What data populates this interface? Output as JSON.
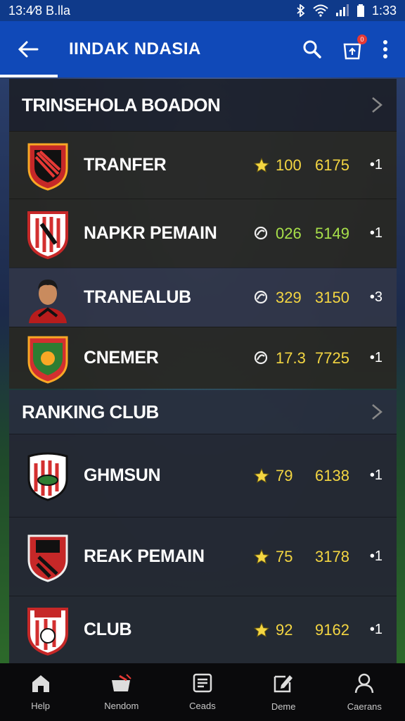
{
  "status": {
    "left": "13:4⁄8 B.lla",
    "time": "1:33"
  },
  "header": {
    "title": "IINDAK NDASIA",
    "notification_count": "0"
  },
  "section1": {
    "title": "TRINSEHOLA BOADON",
    "rows": [
      {
        "name": "TRANFER",
        "v1": "100",
        "v2": "6175",
        "rank": "•1",
        "icon": "star-icon",
        "color": "#f4d642"
      },
      {
        "name": "NAPKR PEMAIN",
        "v1": "026",
        "v2": "5149",
        "rank": "•1",
        "icon": "ball-icon",
        "color": "#a8e04a"
      },
      {
        "name": "TRANEALUB",
        "v1": "329",
        "v2": "3150",
        "rank": "•3",
        "icon": "ball-icon",
        "color": "#f4d642"
      },
      {
        "name": "CNEMER",
        "v1": "17.3",
        "v2": "7725",
        "rank": "•1",
        "icon": "ball-icon",
        "color": "#f4d642"
      }
    ]
  },
  "section2": {
    "title": "RANKING CLUB",
    "rows": [
      {
        "name": "GHMSUN",
        "v1": "79",
        "v2": "6138",
        "rank": "•1",
        "icon": "star-icon",
        "color": "#f4d642"
      },
      {
        "name": "REAK PEMAIN",
        "v1": "75",
        "v2": "3178",
        "rank": "•1",
        "icon": "star-icon",
        "color": "#f4d642"
      },
      {
        "name": "CLUB",
        "v1": "92",
        "v2": "9162",
        "rank": "•1",
        "icon": "star-icon",
        "color": "#f4d642"
      }
    ]
  },
  "nav": [
    {
      "label": "Help",
      "icon": "home-icon"
    },
    {
      "label": "Nendom",
      "icon": "cart-icon"
    },
    {
      "label": "Ceads",
      "icon": "list-icon"
    },
    {
      "label": "Deme",
      "icon": "edit-icon"
    },
    {
      "label": "Caerans",
      "icon": "user-icon"
    }
  ]
}
